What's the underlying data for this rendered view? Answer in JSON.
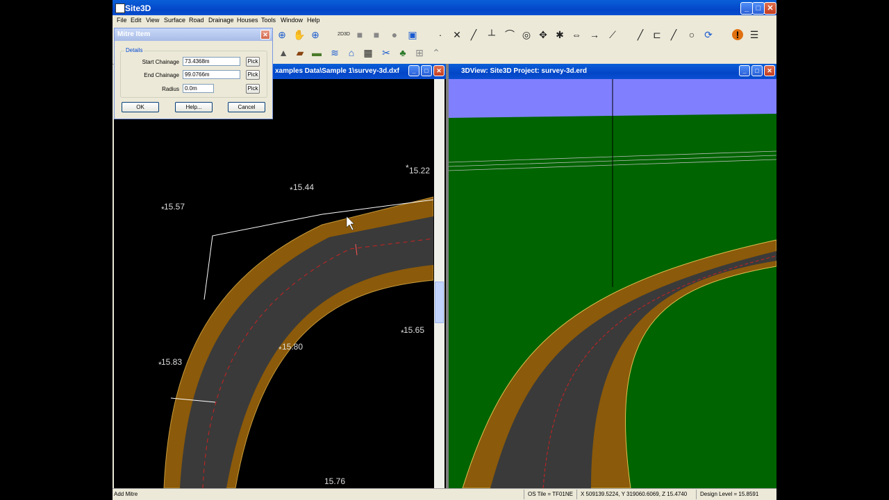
{
  "app": {
    "title": "Site3D",
    "menu": [
      "File",
      "Edit",
      "View",
      "Surface",
      "Road",
      "Drainage",
      "Houses",
      "Tools",
      "Window",
      "Help"
    ],
    "minimize_glyph": "_",
    "maximize_glyph": "□",
    "close_glyph": "✕"
  },
  "icons": {
    "zoom-icon": "⊕",
    "pan-hand-icon": "✋",
    "zoom-extents-icon": "⊕",
    "2d3d-icon": "2D3D",
    "shaded-view-icon": "■",
    "render-icon": "■",
    "sphere-icon": "●",
    "view-mode-icon": "▣",
    "point-icon": "·",
    "cross-icon": "✕",
    "line-tool-icon": "╱",
    "perpendicular-icon": "┴",
    "arc-icon": "⌒",
    "circle-target-icon": "◎",
    "move-icon": "✥",
    "star-icon": "✱",
    "stretch-icon": "⇔",
    "arrow-right-icon": "→",
    "measure-icon": "⟋",
    "line-icon": "╱",
    "dimension-icon": "⊏",
    "slash-icon": "╱",
    "node-icon": "○",
    "rotate-icon": "⟳",
    "warning-icon": "!",
    "list-icon": "☰",
    "surface-icon": "▲",
    "volume-icon": "▰",
    "earthworks-icon": "▬",
    "drainage-icon": "≋",
    "house-icon": "⌂",
    "calculator-icon": "▦",
    "cut-icon": "✂",
    "tree-icon": "♣",
    "grid-icon": "⊞",
    "profile-icon": "⌃"
  },
  "plan_window": {
    "title": "xamples Data\\Sample 1\\survey-3d.dxf",
    "spot_levels": [
      "15.22",
      "15.44",
      "15.57",
      "15.65",
      "15.80",
      "15.83",
      "15.76"
    ]
  },
  "view3d_window": {
    "title": "3DView: Site3D Project: survey-3d.erd"
  },
  "dialog": {
    "title": "Mitre Item",
    "group": "Details",
    "start_label": "Start Chainage",
    "start_value": "73.4368m",
    "end_label": "End Chainage",
    "end_value": "99.0766m",
    "radius_label": "Radius",
    "radius_value": "0.0m",
    "pick": "Pick",
    "ok": "OK",
    "help": "Help...",
    "cancel": "Cancel"
  },
  "status": {
    "message": "Add Mitre",
    "os_tile": "OS Tile = TF01NE",
    "coords": "X 509139.5224, Y 319060.6069, Z 15.4740",
    "design_level": "Design Level = 15.8591"
  },
  "colors": {
    "road_surface": "#3a3a3a",
    "road_verge": "#8b5a0a",
    "ground": "#006400",
    "sky": "#8080ff",
    "centerline": "#cc2222"
  }
}
